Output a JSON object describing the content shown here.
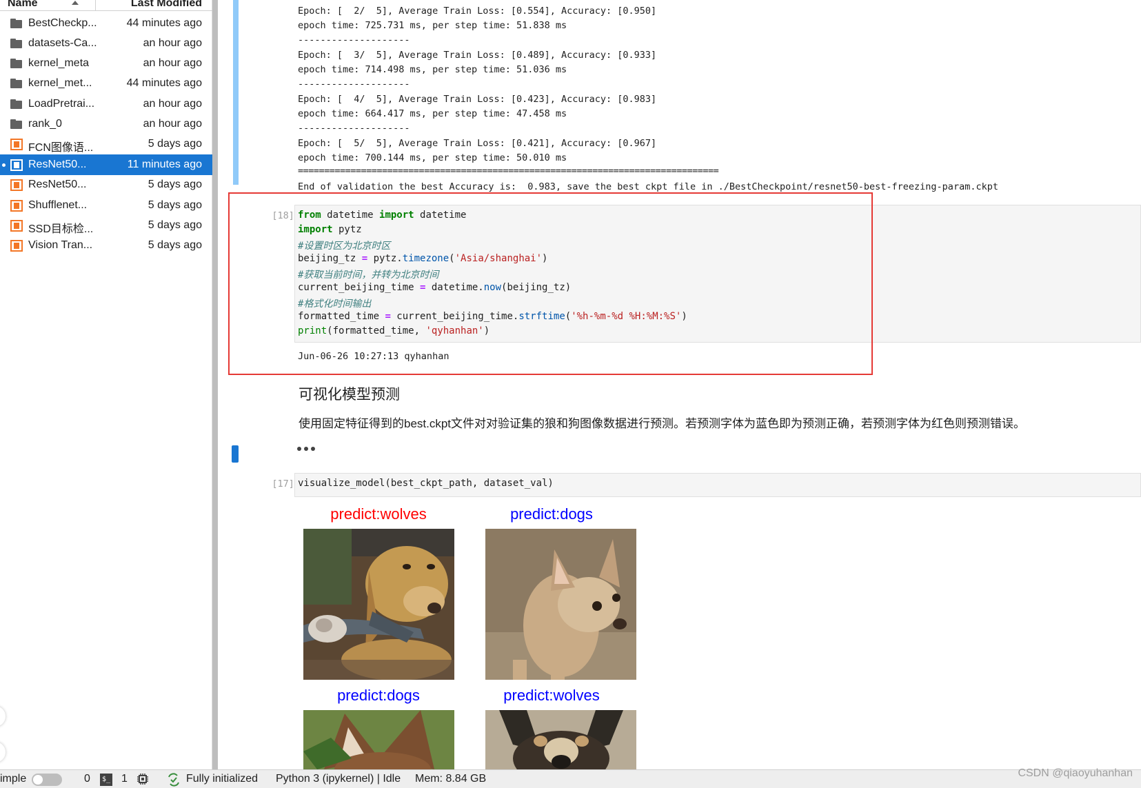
{
  "file_browser": {
    "header": {
      "name_label": "Name",
      "modified_label": "Last Modified"
    },
    "files": [
      {
        "name": "BestCheckp...",
        "modified": "44 minutes ago",
        "kind": "folder",
        "selected": false
      },
      {
        "name": "datasets-Ca...",
        "modified": "an hour ago",
        "kind": "folder",
        "selected": false
      },
      {
        "name": "kernel_meta",
        "modified": "an hour ago",
        "kind": "folder",
        "selected": false
      },
      {
        "name": "kernel_met...",
        "modified": "44 minutes ago",
        "kind": "folder",
        "selected": false
      },
      {
        "name": "LoadPretrai...",
        "modified": "an hour ago",
        "kind": "folder",
        "selected": false
      },
      {
        "name": "rank_0",
        "modified": "an hour ago",
        "kind": "folder",
        "selected": false
      },
      {
        "name": "FCN图像语...",
        "modified": "5 days ago",
        "kind": "notebook",
        "selected": false
      },
      {
        "name": "ResNet50...",
        "modified": "11 minutes ago",
        "kind": "notebook",
        "selected": true
      },
      {
        "name": "ResNet50...",
        "modified": "5 days ago",
        "kind": "notebook",
        "selected": false
      },
      {
        "name": "Shufflenet...",
        "modified": "5 days ago",
        "kind": "notebook",
        "selected": false
      },
      {
        "name": "SSD目标检...",
        "modified": "5 days ago",
        "kind": "notebook",
        "selected": false
      },
      {
        "name": "Vision Tran...",
        "modified": "5 days ago",
        "kind": "notebook",
        "selected": false
      }
    ]
  },
  "training_output": {
    "lines": [
      "Epoch: [  2/  5], Average Train Loss: [0.554], Accuracy: [0.950]",
      "epoch time: 725.731 ms, per step time: 51.838 ms",
      "--------------------",
      "Epoch: [  3/  5], Average Train Loss: [0.489], Accuracy: [0.933]",
      "epoch time: 714.498 ms, per step time: 51.036 ms",
      "--------------------",
      "Epoch: [  4/  5], Average Train Loss: [0.423], Accuracy: [0.983]",
      "epoch time: 664.417 ms, per step time: 47.458 ms",
      "--------------------",
      "Epoch: [  5/  5], Average Train Loss: [0.421], Accuracy: [0.967]",
      "epoch time: 700.144 ms, per step time: 50.010 ms",
      "================================================================================",
      "End of validation the best Accuracy is:  0.983, save the best ckpt file in ./BestCheckpoint/resnet50-best-freezing-param.ckpt"
    ]
  },
  "cell_18": {
    "prompt": "[18]:",
    "code": {
      "l1": {
        "kw1": "from",
        "mod": " datetime ",
        "kw2": "import",
        "name": " datetime"
      },
      "l2": {
        "kw": "import",
        "name": " pytz"
      },
      "l3": "#设置时区为北京时区",
      "l4": {
        "var": "beijing_tz ",
        "op": "=",
        "obj": " pytz.",
        "fn": "timezone",
        "open": "(",
        "arg": "'Asia/shanghai'",
        "close": ")"
      },
      "l5": "#获取当前时间，并转为北京时间",
      "l6": {
        "var": "current_beijing_time ",
        "op": "=",
        "obj": " datetime.",
        "fn": "now",
        "args": "(beijing_tz)"
      },
      "l7": "#格式化时间输出",
      "l8": {
        "var": "formatted_time ",
        "op": "=",
        "obj": " current_beijing_time.",
        "fn": "strftime",
        "open": "(",
        "arg": "'%h-%m-%d %H:%M:%S'",
        "close": ")"
      },
      "l9": {
        "fn": "print",
        "open": "(formatted_time, ",
        "arg": "'qyhanhan'",
        "close": ")"
      }
    },
    "output": "Jun-06-26 10:27:13 qyhanhan"
  },
  "markdown": {
    "heading": "可视化模型预测",
    "paragraph": "使用固定特征得到的best.ckpt文件对对验证集的狼和狗图像数据进行预测。若预测字体为蓝色即为预测正确，若预测字体为红色则预测错误。"
  },
  "cell_17": {
    "prompt": "[17]:",
    "code": "visualize_model(best_ckpt_path, dataset_val)",
    "predictions": [
      {
        "label": "predict:wolves",
        "color": "#ff0000"
      },
      {
        "label": "predict:dogs",
        "color": "#0000ff"
      },
      {
        "label": "predict:dogs",
        "color": "#0000ff"
      },
      {
        "label": "predict:wolves",
        "color": "#0000ff"
      }
    ]
  },
  "status_bar": {
    "mode_label": "imple",
    "terminals_count": "0",
    "kernels_count": "1",
    "init_status": "Fully initialized",
    "kernel_status": "Python 3 (ipykernel) | Idle",
    "memory": "Mem: 8.84 GB"
  },
  "watermark": "CSDN @qiaoyuhanhan"
}
